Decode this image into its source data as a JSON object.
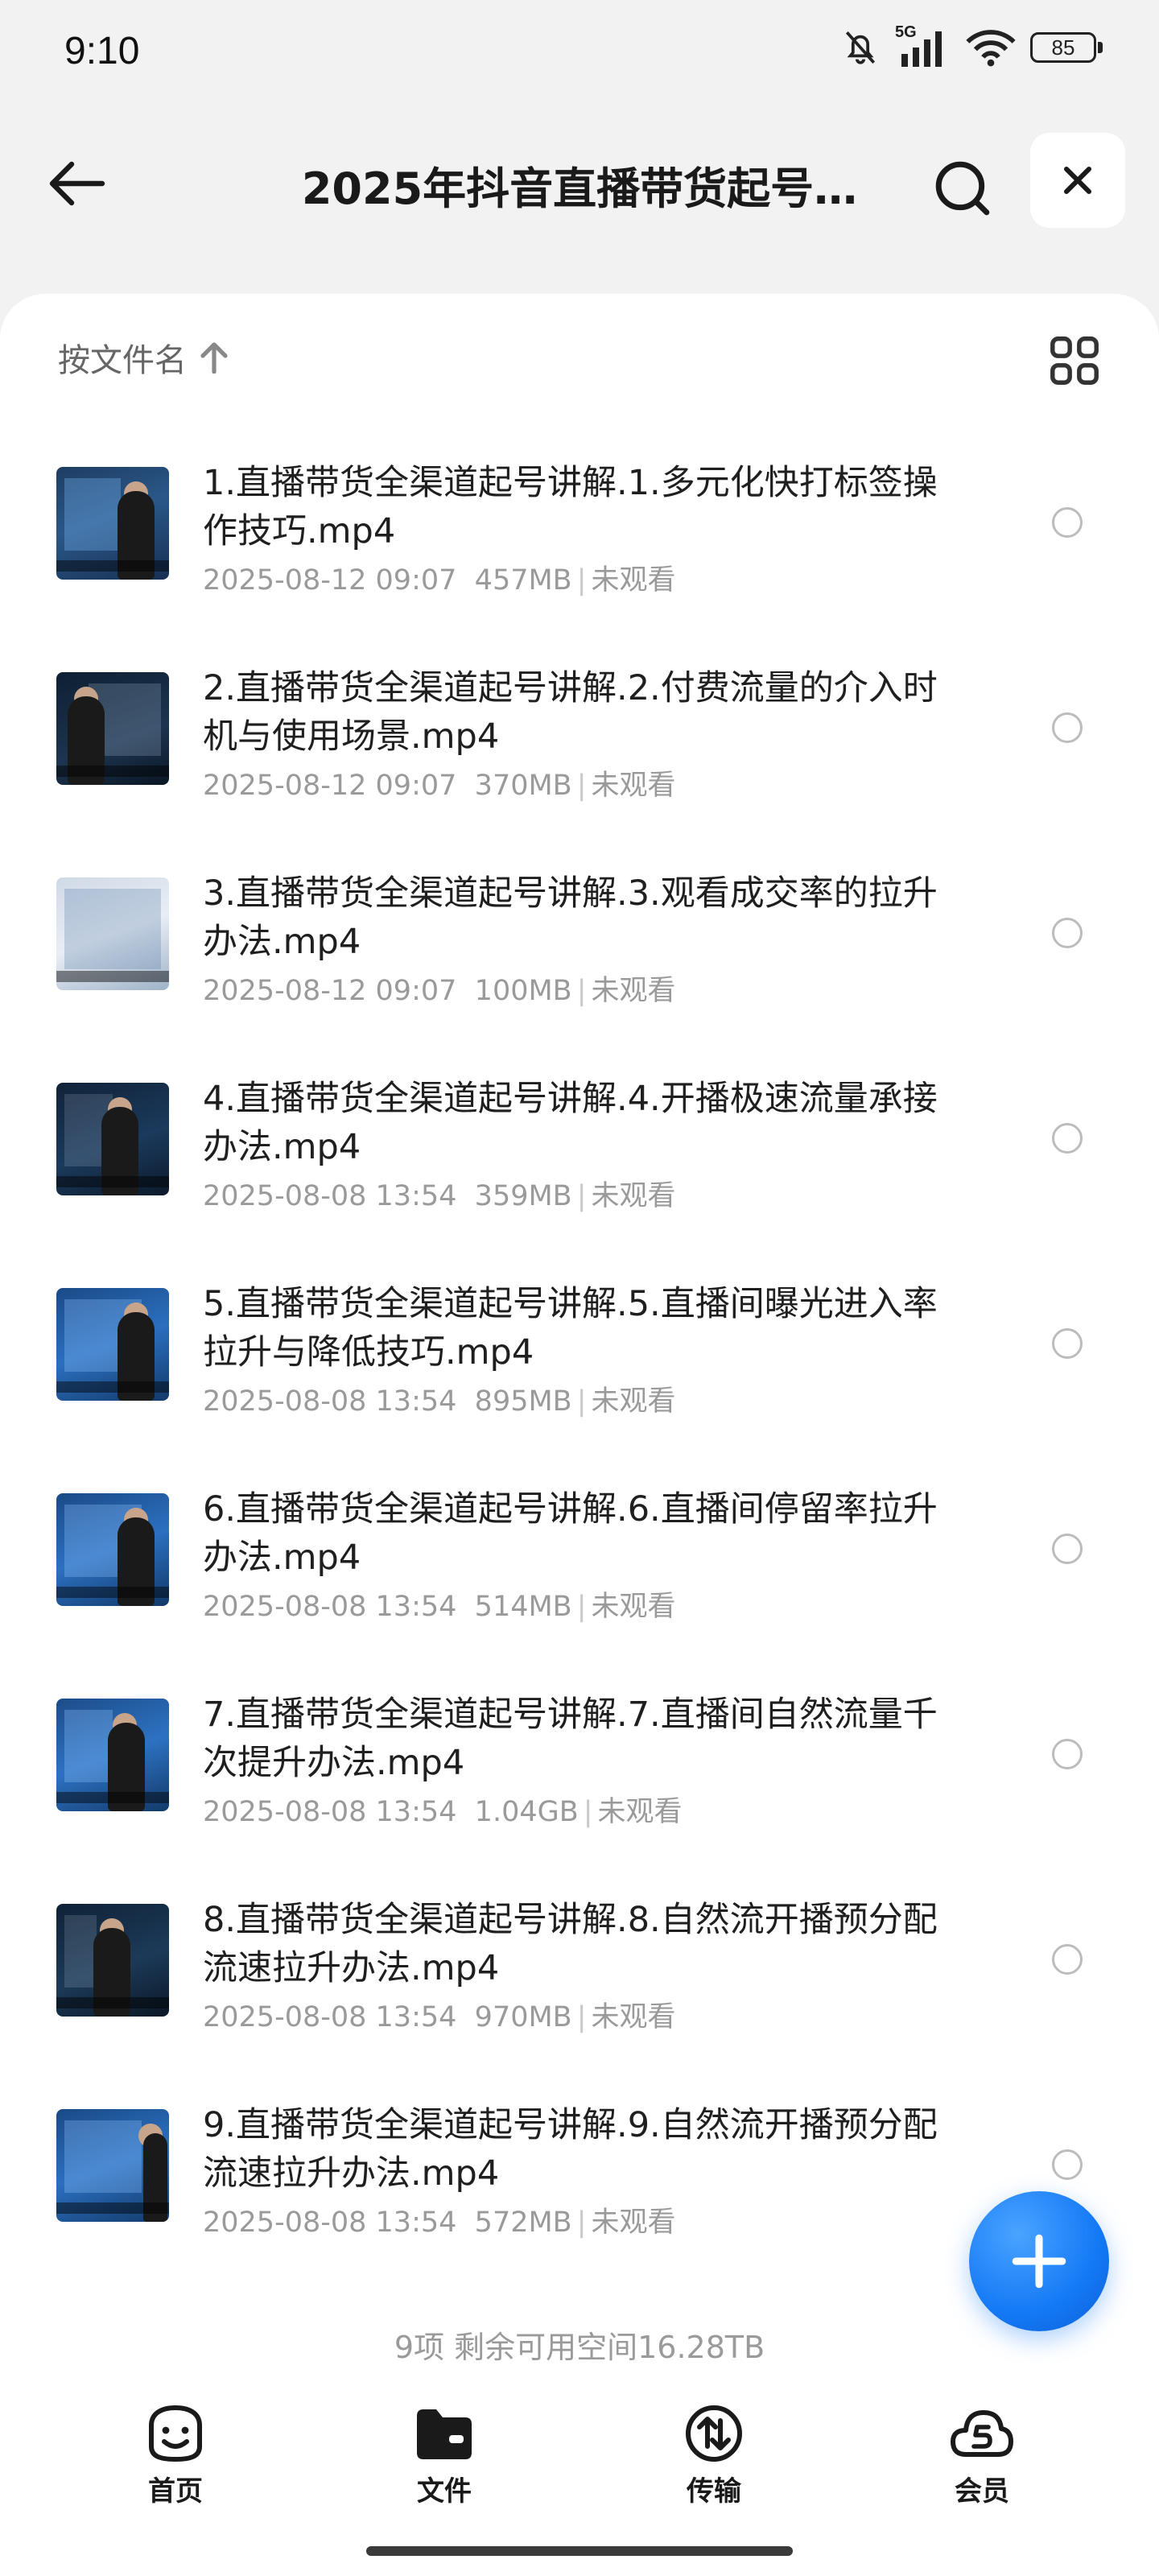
{
  "status_bar": {
    "time": "9:10",
    "network": "5G",
    "battery": "85",
    "icons": [
      "bell-muted-icon",
      "signal-icon",
      "wifi-icon",
      "battery-icon"
    ]
  },
  "header": {
    "title": "2025年抖音直播带货起号…",
    "back_icon": "back-arrow-icon",
    "search_icon": "search-icon",
    "close_icon": "close-icon"
  },
  "toolbar": {
    "sort_label": "按文件名",
    "sort_icon": "arrow-up-icon",
    "view_icon": "grid-view-icon"
  },
  "files": [
    {
      "name": "1.直播带货全渠道起号讲解.1.多元化快打标签操作技巧.mp4",
      "date": "2025-08-12 09:07",
      "size": "457MB",
      "status": "未观看"
    },
    {
      "name": "2.直播带货全渠道起号讲解.2.付费流量的介入时机与使用场景.mp4",
      "date": "2025-08-12 09:07",
      "size": "370MB",
      "status": "未观看"
    },
    {
      "name": "3.直播带货全渠道起号讲解.3.观看成交率的拉升办法.mp4",
      "date": "2025-08-12 09:07",
      "size": "100MB",
      "status": "未观看"
    },
    {
      "name": "4.直播带货全渠道起号讲解.4.开播极速流量承接办法.mp4",
      "date": "2025-08-08 13:54",
      "size": "359MB",
      "status": "未观看"
    },
    {
      "name": "5.直播带货全渠道起号讲解.5.直播间曝光进入率拉升与降低技巧.mp4",
      "date": "2025-08-08 13:54",
      "size": "895MB",
      "status": "未观看"
    },
    {
      "name": "6.直播带货全渠道起号讲解.6.直播间停留率拉升办法.mp4",
      "date": "2025-08-08 13:54",
      "size": "514MB",
      "status": "未观看"
    },
    {
      "name": "7.直播带货全渠道起号讲解.7.直播间自然流量千次提升办法.mp4",
      "date": "2025-08-08 13:54",
      "size": "1.04GB",
      "status": "未观看"
    },
    {
      "name": "8.直播带货全渠道起号讲解.8.自然流开播预分配流速拉升办法.mp4",
      "date": "2025-08-08 13:54",
      "size": "970MB",
      "status": "未观看"
    },
    {
      "name": "9.直播带货全渠道起号讲解.9.自然流开播预分配流速拉升办法.mp4",
      "date": "2025-08-08 13:54",
      "size": "572MB",
      "status": "未观看"
    }
  ],
  "footer": {
    "summary": "9项 剩余可用空间16.28TB"
  },
  "fab": {
    "icon": "plus-icon",
    "color": "#1479f5"
  },
  "nav": [
    {
      "label": "首页",
      "icon": "smiley-home-icon"
    },
    {
      "label": "文件",
      "icon": "folder-icon",
      "active": true
    },
    {
      "label": "传输",
      "icon": "transfer-icon"
    },
    {
      "label": "会员",
      "icon": "cloud-member-icon"
    }
  ]
}
